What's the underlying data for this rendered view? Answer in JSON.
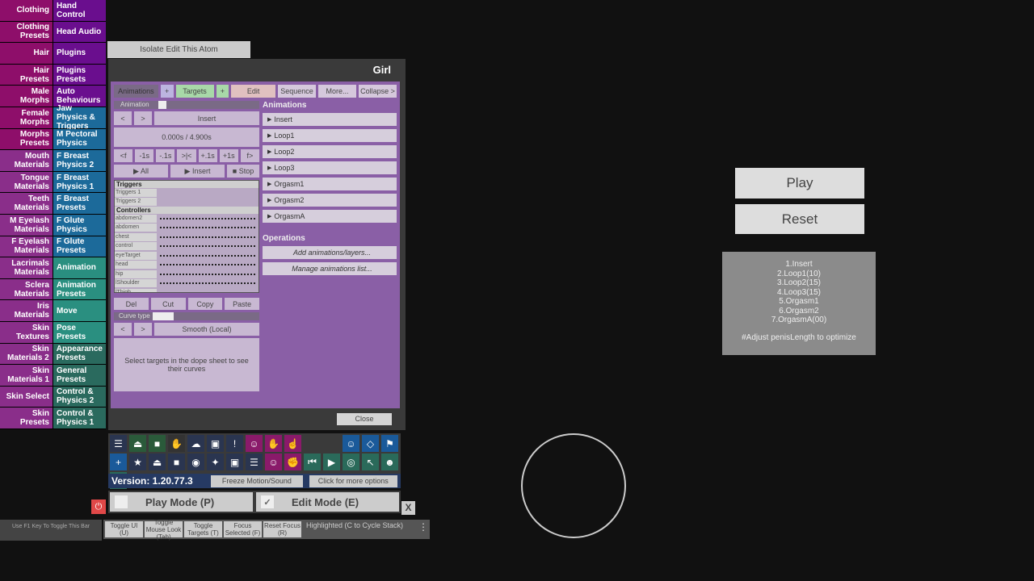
{
  "sidebar": {
    "rows": [
      {
        "left": "Clothing",
        "right": "Hand Control",
        "lcolor": "#8e0e6a",
        "rcolor": "#6a0e8e"
      },
      {
        "left": "Clothing Presets",
        "right": "Head Audio",
        "lcolor": "#8e0e6a",
        "rcolor": "#6a0e8e"
      },
      {
        "left": "Hair",
        "right": "Plugins",
        "lcolor": "#8e0e6a",
        "rcolor": "#6a0e8e"
      },
      {
        "left": "Hair Presets",
        "right": "Plugins Presets",
        "lcolor": "#8e0e6a",
        "rcolor": "#6a0e8e"
      },
      {
        "left": "Male Morphs",
        "right": "Auto Behaviours",
        "lcolor": "#8e0e6a",
        "rcolor": "#6a0e8e"
      },
      {
        "left": "Female Morphs",
        "right": "Jaw Physics & Triggers",
        "lcolor": "#8e0e6a",
        "rcolor": "#1c6a9a"
      },
      {
        "left": "Morphs Presets",
        "right": "M Pectoral Physics",
        "lcolor": "#8e0e6a",
        "rcolor": "#1c6a9a"
      },
      {
        "left": "Mouth Materials",
        "right": "F Breast Physics 2",
        "lcolor": "#8a2e8a",
        "rcolor": "#1c6a9a"
      },
      {
        "left": "Tongue Materials",
        "right": "F Breast Physics 1",
        "lcolor": "#8a2e8a",
        "rcolor": "#1c6a9a"
      },
      {
        "left": "Teeth Materials",
        "right": "F Breast Presets",
        "lcolor": "#8a2e8a",
        "rcolor": "#1c6a9a"
      },
      {
        "left": "M Eyelash Materials",
        "right": "F Glute Physics",
        "lcolor": "#8a2e8a",
        "rcolor": "#1c6a9a"
      },
      {
        "left": "F Eyelash Materials",
        "right": "F Glute Presets",
        "lcolor": "#8a2e8a",
        "rcolor": "#1c6a9a"
      },
      {
        "left": "Lacrimals Materials",
        "right": "Animation",
        "lcolor": "#8a2e8a",
        "rcolor": "#2a8f80"
      },
      {
        "left": "Sclera Materials",
        "right": "Animation Presets",
        "lcolor": "#8a2e8a",
        "rcolor": "#2a8f80"
      },
      {
        "left": "Iris Materials",
        "right": "Move",
        "lcolor": "#8a2e8a",
        "rcolor": "#2a8f80"
      },
      {
        "left": "Skin Textures",
        "right": "Pose Presets",
        "lcolor": "#8a2e8a",
        "rcolor": "#2a8f80"
      },
      {
        "left": "Skin Materials 2",
        "right": "Appearance Presets",
        "lcolor": "#8a2e8a",
        "rcolor": "#2a6a5e"
      },
      {
        "left": "Skin Materials 1",
        "right": "General Presets",
        "lcolor": "#8a2e8a",
        "rcolor": "#2a6a5e"
      },
      {
        "left": "Skin Select",
        "right": "Control & Physics 2",
        "lcolor": "#8a2e8a",
        "rcolor": "#2a6a5e"
      },
      {
        "left": "Skin Presets",
        "right": "Control & Physics 1",
        "lcolor": "#8a2e8a",
        "rcolor": "#2a6a5e"
      }
    ]
  },
  "isolate_label": "Isolate Edit This Atom",
  "panel": {
    "title": "Girl",
    "tabs": [
      "Animations",
      "+",
      "Targets",
      "+",
      "Edit",
      "Sequence",
      "More...",
      "Collapse >"
    ],
    "animation_label": "Animation",
    "prev": "<",
    "next": ">",
    "current_animation": "Insert",
    "time": "0.000s / 4.900s",
    "step_buttons": [
      "<f",
      "-1s",
      "-.1s",
      ">|<",
      "+.1s",
      "+1s",
      "f>"
    ],
    "play_all": "▶ All",
    "play_insert": "▶ Insert",
    "stop": "■ Stop",
    "dope": {
      "triggers_header": "Triggers",
      "triggers": [
        "Triggers 1",
        "Triggers 2"
      ],
      "controllers_header": "Controllers",
      "controllers": [
        "abdomen2",
        "abdomen",
        "chest",
        "control",
        "eyeTarget",
        "head",
        "hip",
        "lShoulder",
        "lThigh"
      ]
    },
    "edit_buttons": [
      "Del",
      "Cut",
      "Copy",
      "Paste"
    ],
    "curve_type_label": "Curve type",
    "curve_value": "Smooth (Local)",
    "hint": "Select targets in the dope sheet to see their curves",
    "animations_header": "Animations",
    "animations": [
      "Insert",
      "Loop1",
      "Loop2",
      "Loop3",
      "Orgasm1",
      "Orgasm2",
      "OrgasmA"
    ],
    "operations_header": "Operations",
    "add_op": "Add animations/layers...",
    "manage_op": "Manage animations list...",
    "close": "Close"
  },
  "toolbar": {
    "icons": [
      "menu",
      "scene-load",
      "folder-open",
      "hand-red",
      "cloud",
      "box",
      "alert",
      "person-add",
      "hand",
      "pointer-hand",
      "spacer",
      "spacer",
      "person",
      "unity",
      "flag",
      "plus",
      "star",
      "scene-save",
      "folder-save",
      "camera",
      "nodes",
      "package",
      "document",
      "person-remove",
      "grab",
      "rewind",
      "play",
      "target",
      "cursor",
      "people",
      "tools"
    ]
  },
  "version": "Version: 1.20.77.3",
  "freeze": "Freeze Motion/Sound",
  "more_options": "Click for more options",
  "play_mode": "Play Mode (P)",
  "edit_mode": "Edit Mode (E)",
  "edit_check": "✓",
  "x_label": "X",
  "bottom": {
    "buttons": [
      "Toggle UI (U)",
      "Toggle Mouse Look (Tab)",
      "Toggle Targets (T)",
      "Focus Selected (F)",
      "Reset Focus (R)"
    ],
    "status": "Highlighted (C to Cycle Stack)",
    "f1_hint": "Use F1 Key To Toggle This Bar"
  },
  "scene": {
    "play": "Play",
    "reset": "Reset",
    "notes": [
      "1.Insert",
      "2.Loop1(10)",
      "3.Loop2(15)",
      "4.Loop3(15)",
      "5.Orgasm1",
      "6.Orgasm2",
      "7.OrgasmA(00)"
    ],
    "notes_hint": "#Adjust penisLength to optimize"
  }
}
